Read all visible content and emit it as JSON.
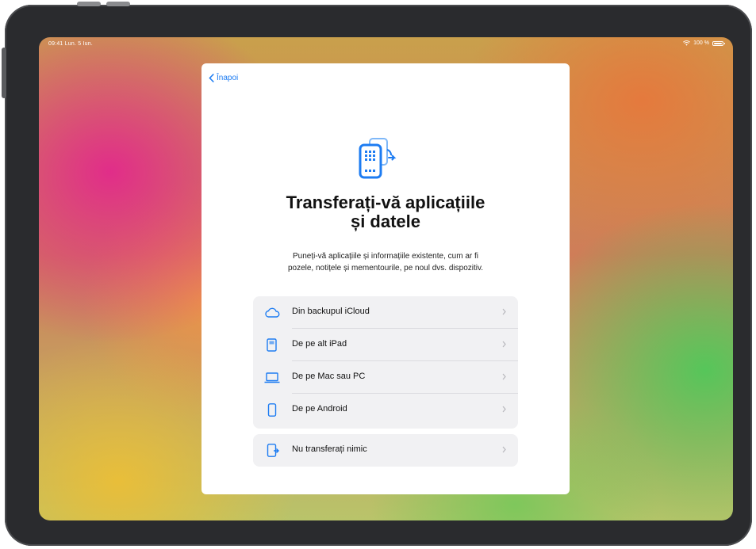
{
  "status_bar": {
    "time_date": "09:41 Lun. 5 Iun.",
    "battery": "100 %"
  },
  "sheet": {
    "back_label": "Înapoi",
    "title_line1": "Transferați-vă aplicațiile",
    "title_line2": "și datele",
    "subtitle_line1": "Puneți-vă aplicațiile și informațiile existente, cum ar fi",
    "subtitle_line2": "pozele, notițele și mementourile, pe noul dvs. dispozitiv.",
    "options": [
      {
        "label": "Din backupul iCloud",
        "icon": "cloud-icon"
      },
      {
        "label": "De pe alt iPad",
        "icon": "ipad-icon"
      },
      {
        "label": "De pe Mac sau PC",
        "icon": "laptop-icon"
      },
      {
        "label": "De pe Android",
        "icon": "phone-icon"
      }
    ],
    "skip_option": {
      "label": "Nu transferați nimic",
      "icon": "no-transfer-icon"
    }
  },
  "colors": {
    "accent": "#1d7cf2",
    "sheet_bg": "#ffffff",
    "row_bg": "#f1f1f3"
  }
}
